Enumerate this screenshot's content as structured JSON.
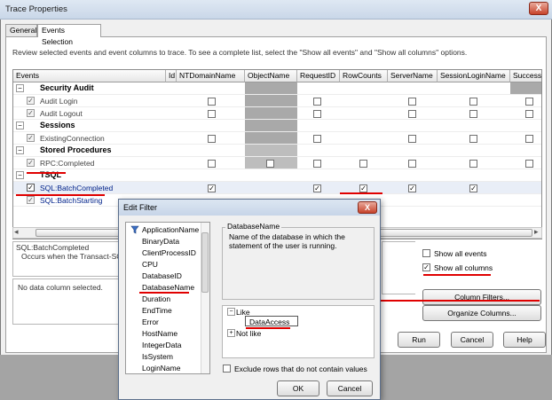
{
  "window": {
    "title": "Trace Properties",
    "close": "X"
  },
  "tabs": [
    {
      "label": "General"
    },
    {
      "label": "Events Selection"
    }
  ],
  "description": "Review selected events and event columns to trace. To see a complete list, select the \"Show all events\" and \"Show all columns\" options.",
  "grid": {
    "columns": [
      "Events",
      "Id",
      "NTDomainName",
      "ObjectName",
      "RequestID",
      "RowCounts",
      "ServerName",
      "SessionLoginName",
      "Success"
    ],
    "rows": [
      {
        "type": "category",
        "label": "Security Audit"
      },
      {
        "type": "event",
        "label": "Audit Login"
      },
      {
        "type": "event",
        "label": "Audit Logout"
      },
      {
        "type": "category",
        "label": "Sessions"
      },
      {
        "type": "event",
        "label": "ExistingConnection"
      },
      {
        "type": "category",
        "label": "Stored Procedures"
      },
      {
        "type": "event",
        "label": "RPC:Completed"
      },
      {
        "type": "category",
        "label": "TSQL"
      },
      {
        "type": "event",
        "label": "SQL:BatchCompleted"
      },
      {
        "type": "event",
        "label": "SQL:BatchStarting"
      }
    ],
    "toggle_minus": "−",
    "check": "✓",
    "scroll_left": "◂",
    "scroll_right": "▸"
  },
  "event_info": {
    "title": "SQL:BatchCompleted",
    "text": "Occurs when the Transact-SQ"
  },
  "column_info": {
    "text": "No data column selected."
  },
  "options": {
    "show_all_events": "Show all events",
    "show_all_columns": "Show all columns",
    "check": "✓"
  },
  "buttons": {
    "column_filters": "Column Filters...",
    "organize_columns": "Organize Columns...",
    "run": "Run",
    "cancel": "Cancel",
    "help": "Help"
  },
  "dialog": {
    "title": "Edit Filter",
    "close": "X",
    "columns": [
      "ApplicationName",
      "BinaryData",
      "ClientProcessID",
      "CPU",
      "DatabaseID",
      "DatabaseName",
      "Duration",
      "EndTime",
      "Error",
      "HostName",
      "IntegerData",
      "IsSystem",
      "LoginName"
    ],
    "selected_title": "DatabaseName",
    "selected_desc": "Name of the database in which the statement of the user is running.",
    "tree": {
      "like": "Like",
      "like_value": "DataAccess",
      "not_like": "Not like",
      "minus": "−",
      "plus": "+"
    },
    "exclude": "Exclude rows that do not contain values",
    "ok": "OK",
    "cancel": "Cancel"
  }
}
